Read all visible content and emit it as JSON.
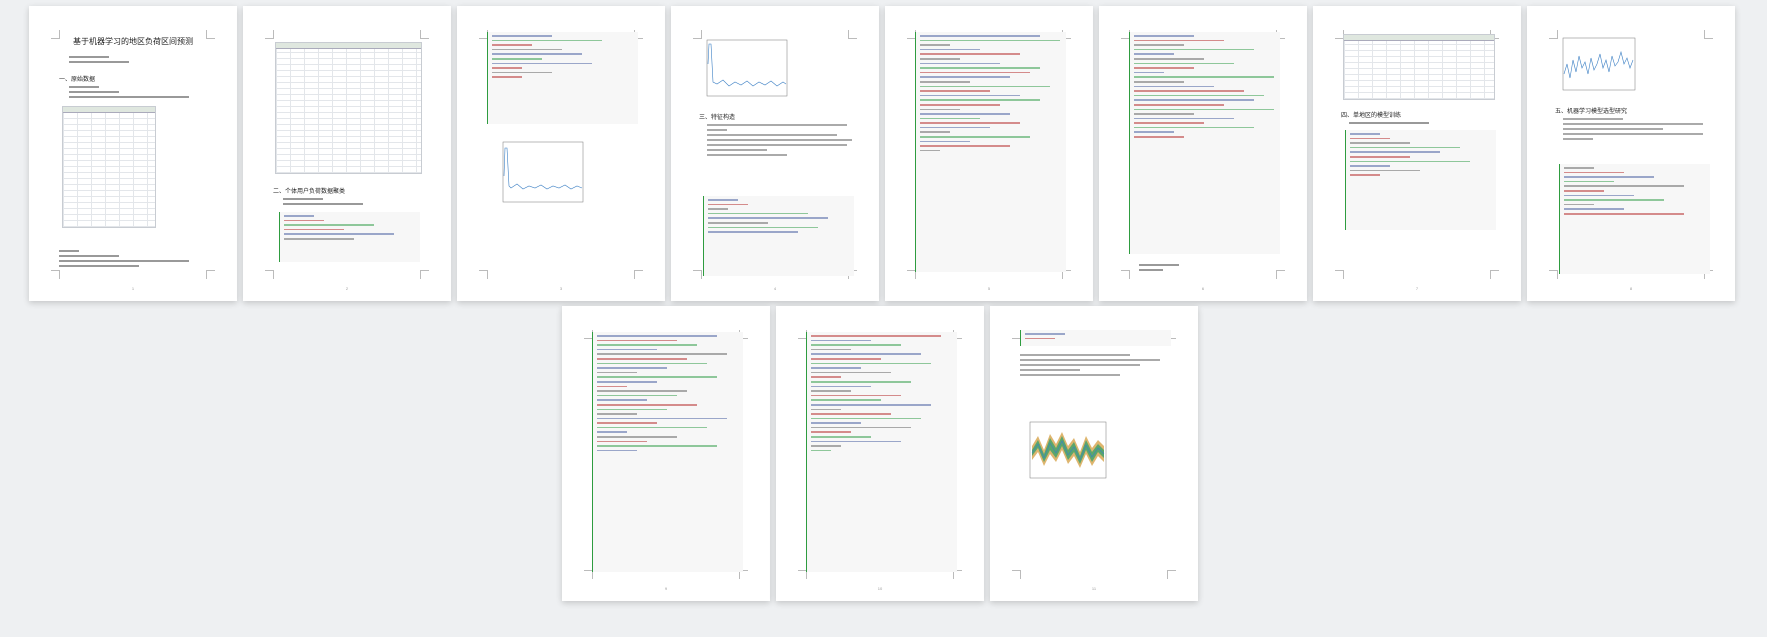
{
  "document": {
    "title": "基于机器学习的地区负荷区间预测",
    "headings": {
      "data_source": "一、原始数据",
      "preprocess": "二、个体用户负荷数据聚类",
      "feature": "三、特征构造",
      "single_user": "四、单地区的模型训练",
      "model_select": "五、机器学习模型选型研究"
    }
  },
  "pages": [
    {
      "number": "1"
    },
    {
      "number": "2"
    },
    {
      "number": "3"
    },
    {
      "number": "4"
    },
    {
      "number": "5"
    },
    {
      "number": "6"
    },
    {
      "number": "7"
    },
    {
      "number": "8"
    },
    {
      "number": "9"
    },
    {
      "number": "10"
    },
    {
      "number": "11"
    }
  ],
  "colors": {
    "background": "#eef0f2",
    "code_border": "#2e9c3f",
    "chart_line": "#3b7fc4",
    "spell_squiggle": "#dd2222"
  }
}
